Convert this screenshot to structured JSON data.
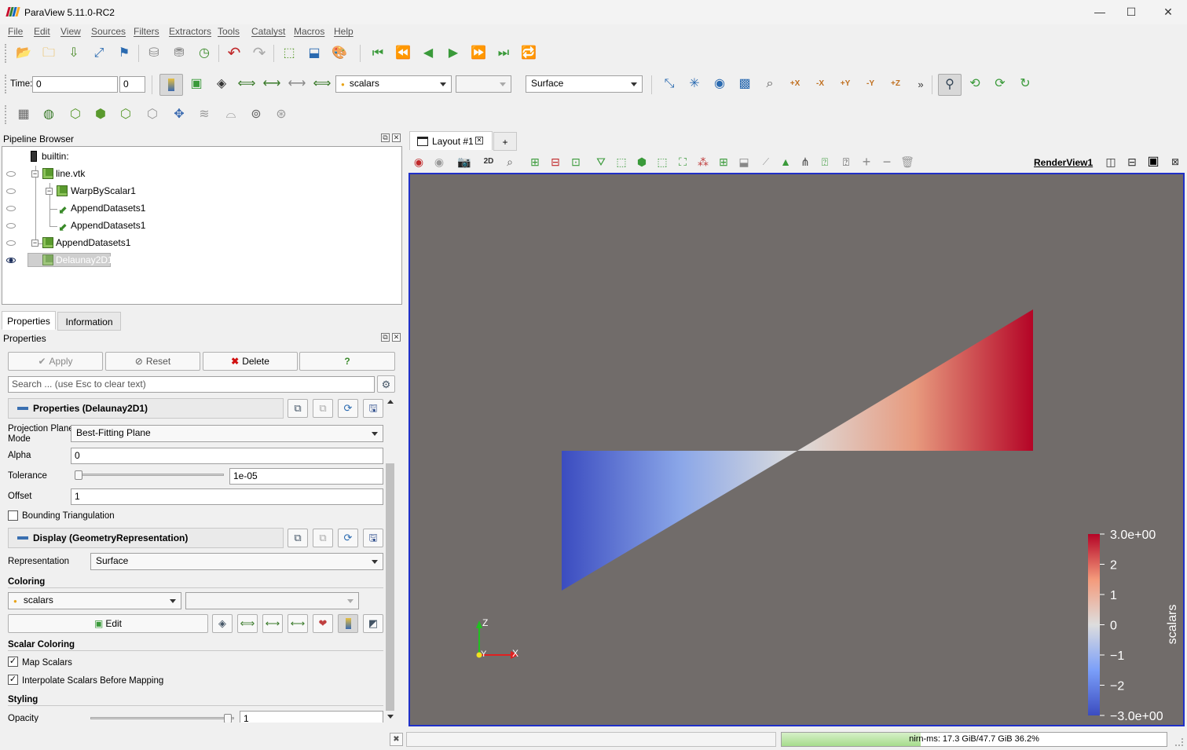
{
  "app": {
    "title": "ParaView 5.11.0-RC2"
  },
  "menu": [
    "File",
    "Edit",
    "View",
    "Sources",
    "Filters",
    "Extractors",
    "Tools",
    "Catalyst",
    "Macros",
    "Help"
  ],
  "toolbar2": {
    "time_label": "Time:",
    "time_value": "0",
    "timestep_value": "0",
    "color_by": "scalars",
    "component": "",
    "representation": "Surface",
    "more": "»"
  },
  "pipeline_browser": {
    "title": "Pipeline Browser",
    "items": [
      {
        "label": "builtin:",
        "visible": false
      },
      {
        "label": "line.vtk",
        "visible": false
      },
      {
        "label": "WarpByScalar1",
        "visible": false
      },
      {
        "label": "AppendDatasets1",
        "visible": false
      },
      {
        "label": "AppendDatasets1",
        "visible": false
      },
      {
        "label": "AppendDatasets1",
        "visible": false
      },
      {
        "label": "Delaunay2D1",
        "visible": true,
        "selected": true
      }
    ]
  },
  "tabs": {
    "properties": "Properties",
    "information": "Information"
  },
  "properties": {
    "title": "Properties",
    "apply": "Apply",
    "reset": "Reset",
    "delete": "Delete",
    "help": "?",
    "search_placeholder": "Search ... (use Esc to clear text)",
    "section1": "Properties (Delaunay2D1)",
    "projection_label_1": "Projection Plane",
    "projection_label_2": "Mode",
    "projection_value": "Best-Fitting Plane",
    "alpha_label": "Alpha",
    "alpha_value": "0",
    "tolerance_label": "Tolerance",
    "tolerance_value": "1e-05",
    "offset_label": "Offset",
    "offset_value": "1",
    "bounding_label": "Bounding Triangulation",
    "section2": "Display (GeometryRepresentation)",
    "representation_label": "Representation",
    "representation_value": "Surface",
    "coloring_header": "Coloring",
    "coloring_value": "scalars",
    "edit_label": "Edit",
    "scalar_coloring_header": "Scalar Coloring",
    "map_scalars_label": "Map Scalars",
    "interpolate_label": "Interpolate Scalars Before Mapping",
    "styling_header": "Styling",
    "opacity_label": "Opacity",
    "opacity_value": "1"
  },
  "layout": {
    "tab_label": "Layout #1",
    "add_tab": "+",
    "view_name": "RenderView1",
    "mode_2d": "2D"
  },
  "colorbar": {
    "title": "scalars",
    "ticks": [
      "3.0e+00",
      "2",
      "1",
      "0",
      "-1",
      "-2",
      "-3.0e+00"
    ],
    "range": [
      -3,
      3
    ],
    "colors": {
      "low": "#3b4cc0",
      "mid": "#dddddd",
      "high": "#b40426"
    }
  },
  "axes": {
    "x": "X",
    "y": "Y",
    "z": "Z"
  },
  "statusbar": {
    "memory": "nirn-ms: 17.3 GiB/47.7 GiB 36.2%",
    "memory_fraction": 0.362
  }
}
